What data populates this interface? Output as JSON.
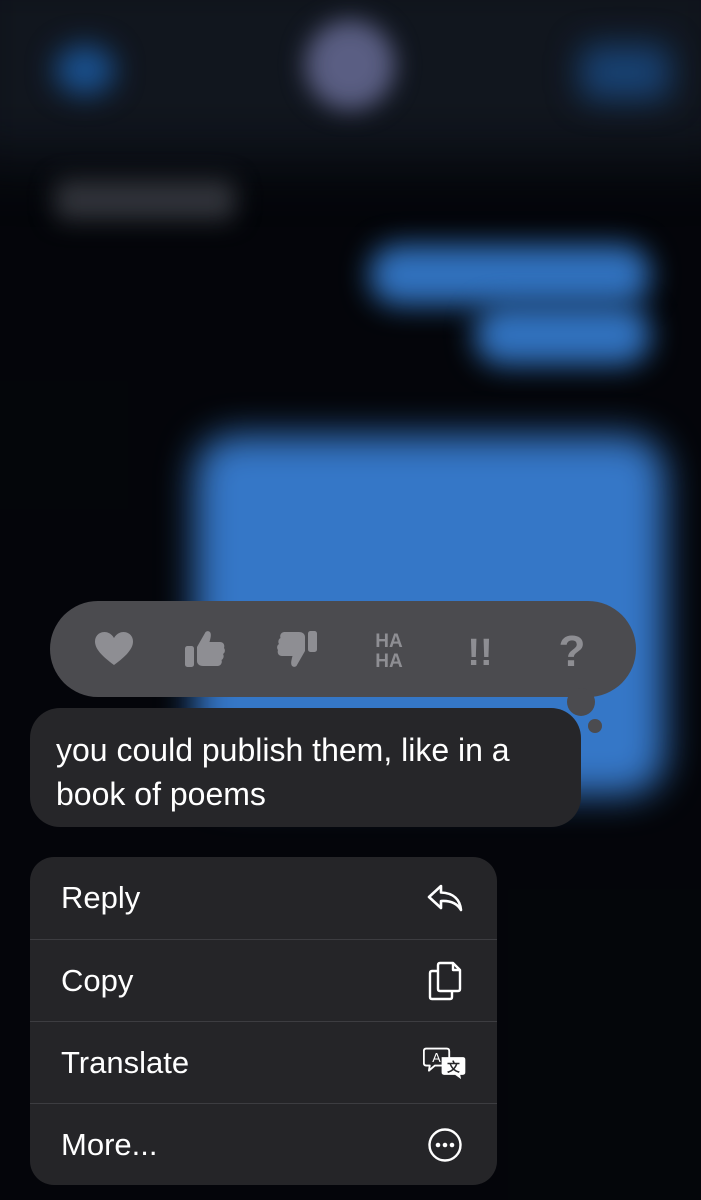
{
  "tapback": {
    "reactions": [
      {
        "icon": "heart-icon"
      },
      {
        "icon": "thumbs-up-icon"
      },
      {
        "icon": "thumbs-down-icon"
      },
      {
        "icon": "haha-icon",
        "line1": "HA",
        "line2": "HA"
      },
      {
        "icon": "exclamation-icon",
        "text": "!!"
      },
      {
        "icon": "question-icon",
        "text": "?"
      }
    ],
    "icon_color": "#8e8e93",
    "background_color": "#4b4b4f"
  },
  "message": {
    "text": "you could publish them, like in a book of poems",
    "bubble_color": "#262629"
  },
  "context_menu": {
    "background_color": "#252528",
    "items": [
      {
        "label": "Reply",
        "icon": "reply-icon"
      },
      {
        "label": "Copy",
        "icon": "copy-icon"
      },
      {
        "label": "Translate",
        "icon": "translate-icon"
      },
      {
        "label": "More...",
        "icon": "more-icon"
      }
    ]
  },
  "background": {
    "accent_color": "#3f8cea",
    "base_color": "#05070c"
  }
}
